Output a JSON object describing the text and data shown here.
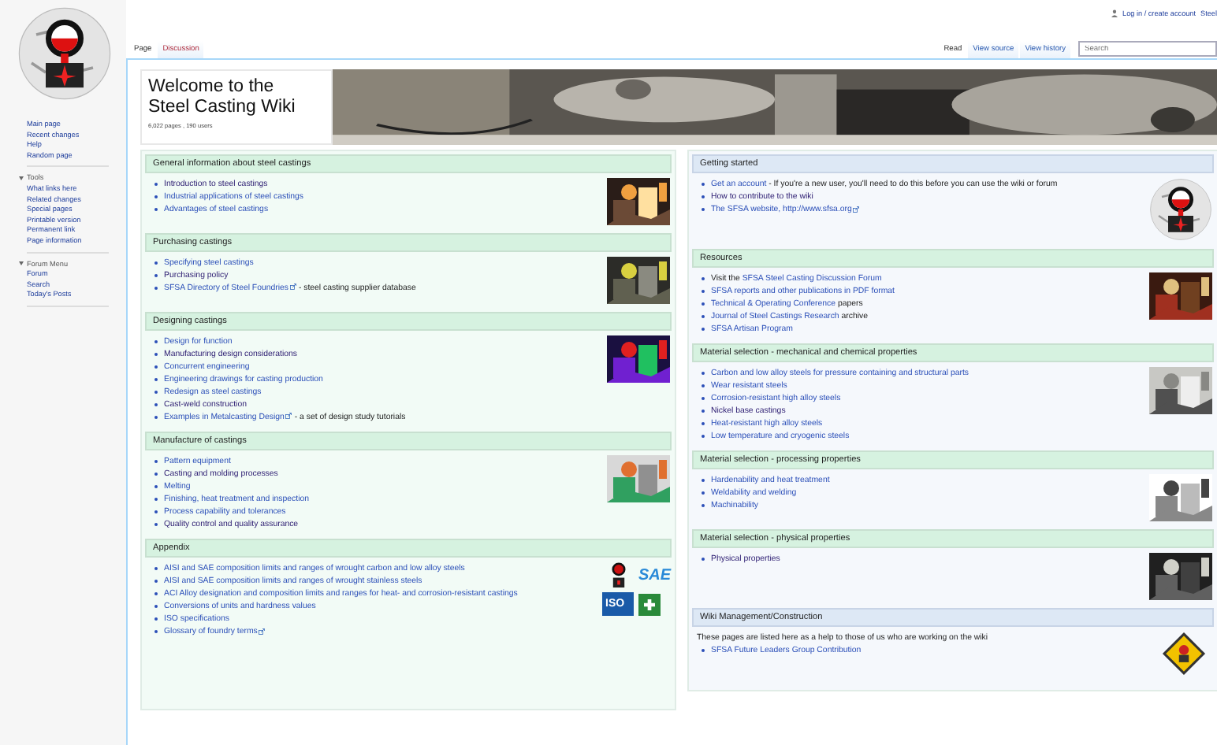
{
  "personal_tools": [
    "Log in / create account",
    "Steel"
  ],
  "sidebar": {
    "navigation": [
      "Main page",
      "Recent changes",
      "Help",
      "Random page"
    ],
    "portals": [
      {
        "title": "Tools",
        "expanded": true,
        "items": [
          "What links here",
          "Related changes",
          "Special pages",
          "Printable version",
          "Permanent link",
          "Page information"
        ]
      },
      {
        "title": "Forum Menu",
        "expanded": true,
        "items": [
          "Forum",
          "Search",
          "Today's Posts"
        ]
      }
    ]
  },
  "tabs_left": [
    {
      "label": "Page",
      "selected": true
    },
    {
      "label": "Discussion",
      "selected": false
    }
  ],
  "tabs_right": [
    {
      "label": "Read",
      "selected": true
    },
    {
      "label": "View source",
      "selected": false
    },
    {
      "label": "View history",
      "selected": false
    }
  ],
  "search": {
    "placeholder": "Search"
  },
  "header": {
    "title_lines": [
      "Welcome to the",
      "Steel Casting Wiki"
    ],
    "stats": "6,022 pages , 190 users"
  },
  "columns": [
    [
      {
        "title": "General information about steel castings",
        "kind": "green",
        "figure": {
          "kind": "picture"
        },
        "items": [
          {
            "link": "Introduction to steel castings",
            "visited": true
          },
          {
            "link": "Industrial applications of steel castings",
            "visited": false
          },
          {
            "link": "Advantages of steel castings",
            "visited": false
          }
        ]
      },
      {
        "title": "Purchasing castings",
        "kind": "green",
        "figure": {
          "kind": "picture"
        },
        "items": [
          {
            "link": "Specifying steel castings",
            "visited": false
          },
          {
            "link": "Purchasing policy",
            "visited": true
          },
          {
            "link": "SFSA Directory of Steel Foundries",
            "visited": false,
            "external": true,
            "suffix": " - steel casting supplier database"
          }
        ]
      },
      {
        "title": "Designing castings",
        "kind": "green",
        "figure": {
          "kind": "picture"
        },
        "items": [
          {
            "link": "Design for function",
            "visited": false
          },
          {
            "link": "Manufacturing design considerations",
            "visited": true
          },
          {
            "link": "Concurrent engineering",
            "visited": false
          },
          {
            "link": "Engineering drawings for casting production",
            "visited": false
          },
          {
            "link": "Redesign as steel castings",
            "visited": false
          },
          {
            "link": "Cast-weld construction",
            "visited": true
          },
          {
            "link": "Examples in Metalcasting Design",
            "visited": false,
            "external": true,
            "suffix": " - a set of design study tutorials"
          }
        ]
      },
      {
        "title": "Manufacture of castings",
        "kind": "green",
        "figure": {
          "kind": "picture"
        },
        "items": [
          {
            "link": "Pattern equipment",
            "visited": false
          },
          {
            "link": "Casting and molding processes",
            "visited": true
          },
          {
            "link": "Melting",
            "visited": false
          },
          {
            "link": "Finishing, heat treatment and inspection",
            "visited": false
          },
          {
            "link": "Process capability and tolerances",
            "visited": false
          },
          {
            "link": "Quality control and quality assurance",
            "visited": true
          }
        ]
      },
      {
        "title": "Appendix",
        "kind": "green",
        "figure": {
          "kind": "badges",
          "texts": [
            "SAE",
            "ISO"
          ]
        },
        "items": [
          {
            "link": "AISI and SAE composition limits and ranges of wrought carbon and low alloy steels",
            "visited": false
          },
          {
            "link": "AISI and SAE composition limits and ranges of wrought stainless steels",
            "visited": false
          },
          {
            "link": "ACI Alloy designation and composition limits and ranges for heat- and corrosion-resistant castings",
            "visited": false
          },
          {
            "link": "Conversions of units and hardness values",
            "visited": false
          },
          {
            "link": "ISO specifications",
            "visited": false
          },
          {
            "link": "Glossary of foundry terms",
            "visited": false,
            "external": true
          }
        ]
      }
    ],
    [
      {
        "title": "Getting started",
        "kind": "blue",
        "figure": {
          "kind": "logo"
        },
        "items": [
          {
            "link": "Get an account",
            "visited": false,
            "suffix": " - If you're a new user, you'll need to do this before you can use the wiki or forum"
          },
          {
            "link": "How to contribute to the wiki",
            "visited": true
          },
          {
            "link": "The SFSA website, http://www.sfsa.org",
            "visited": false,
            "external": true
          }
        ]
      },
      {
        "title": "Resources",
        "kind": "green",
        "figure": {
          "kind": "picture"
        },
        "items": [
          {
            "prefix": "Visit the ",
            "link": "SFSA Steel Casting Discussion Forum",
            "visited": false
          },
          {
            "link": "SFSA reports and other publications in PDF format",
            "visited": false
          },
          {
            "link": "Technical & Operating Conference",
            "visited": false,
            "suffix": " papers"
          },
          {
            "link": "Journal of Steel Castings Research",
            "visited": false,
            "suffix": " archive"
          },
          {
            "link": "SFSA Artisan Program",
            "visited": false
          }
        ]
      },
      {
        "title": "Material selection - mechanical and chemical properties",
        "kind": "green",
        "figure": {
          "kind": "picture"
        },
        "items": [
          {
            "link": "Carbon and low alloy steels for pressure containing and structural parts",
            "visited": false
          },
          {
            "link": "Wear resistant steels",
            "visited": false
          },
          {
            "link": "Corrosion-resistant high alloy steels",
            "visited": false
          },
          {
            "link": "Nickel base castings",
            "visited": true
          },
          {
            "link": "Heat-resistant high alloy steels",
            "visited": false
          },
          {
            "link": "Low temperature and cryogenic steels",
            "visited": false
          }
        ]
      },
      {
        "title": "Material selection - processing properties",
        "kind": "green",
        "figure": {
          "kind": "picture"
        },
        "items": [
          {
            "link": "Hardenability and heat treatment",
            "visited": false
          },
          {
            "link": "Weldability and welding",
            "visited": false
          },
          {
            "link": "Machinability",
            "visited": false
          }
        ]
      },
      {
        "title": "Material selection - physical properties",
        "kind": "green",
        "figure": {
          "kind": "picture"
        },
        "items": [
          {
            "link": "Physical properties",
            "visited": true
          }
        ]
      },
      {
        "title": "Wiki Management/Construction",
        "kind": "blue",
        "intro": "These pages are listed here as a help to those of us who are working on the wiki",
        "figure": {
          "kind": "diamond"
        },
        "items": [
          {
            "link": "SFSA Future Leaders Group Contribution",
            "visited": false
          }
        ]
      }
    ]
  ]
}
